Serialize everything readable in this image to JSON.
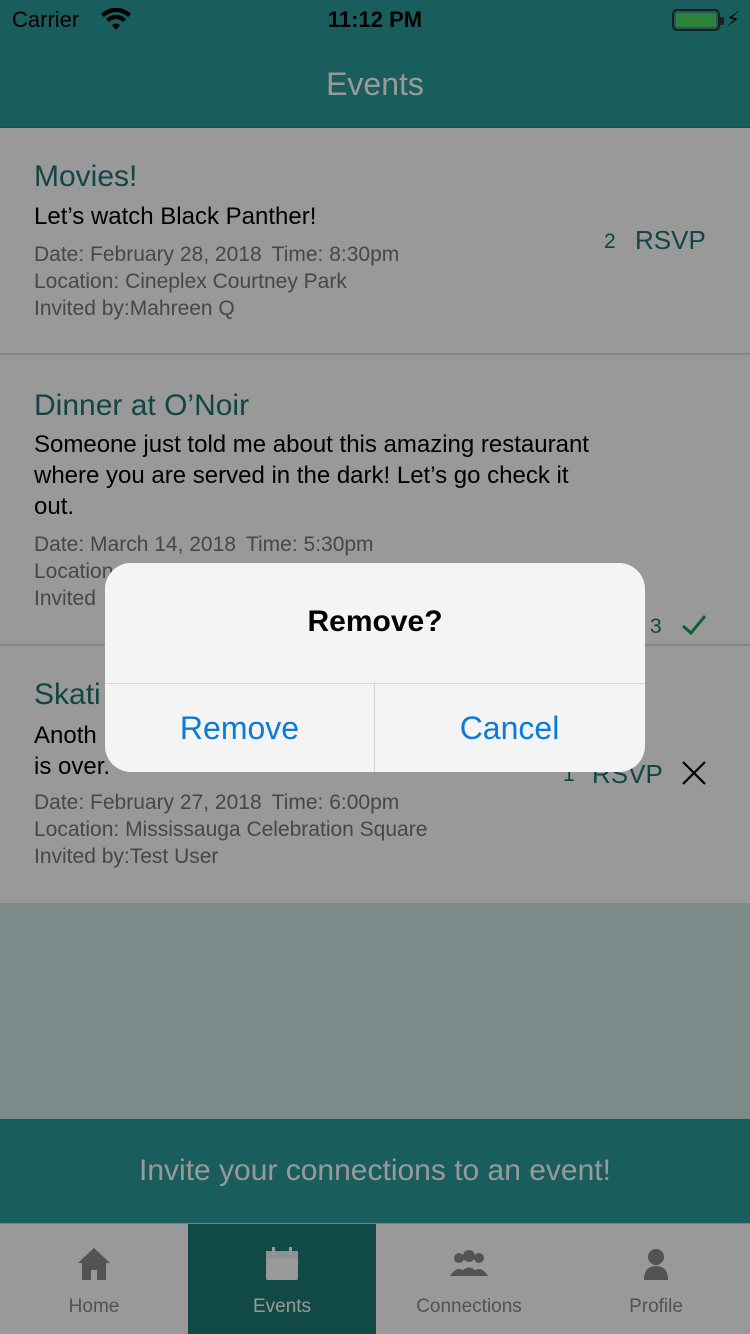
{
  "status_bar": {
    "carrier": "Carrier",
    "time": "11:12 PM",
    "battery_color": "#4cd964"
  },
  "nav": {
    "title": "Events"
  },
  "events": [
    {
      "title": "Movies!",
      "description": "Let’s watch Black Panther!",
      "date": "Date: February 28, 2018",
      "time": "Time: 8:30pm",
      "location": "Location: Cineplex Courtney Park",
      "invited_by": "Invited by:Mahreen Q",
      "count": "2",
      "rsvp_label": "RSVP",
      "status_icon": "none"
    },
    {
      "title": "Dinner at O’Noir",
      "description": "Someone just told me about this amazing restaurant where you are served in the dark! Let’s go check it out.",
      "date": "Date: March 14, 2018",
      "time": "Time: 5:30pm",
      "location": "Location",
      "invited_by": "Invited",
      "count": "3",
      "status_icon": "check-icon"
    },
    {
      "title": "Skati",
      "description_line1": "Anoth",
      "description_line2": "is over.",
      "date": "Date: February 27, 2018",
      "time": "Time: 6:00pm",
      "location": "Location: Mississauga Celebration Square",
      "invited_by": "Invited by:Test User",
      "count": "1",
      "rsvp_label": "RSVP",
      "status_icon": "x-icon"
    }
  ],
  "invite_bar": {
    "label": "Invite your connections to an event!"
  },
  "tabs": [
    {
      "label": "Home",
      "icon": "home-icon",
      "active": false
    },
    {
      "label": "Events",
      "icon": "calendar-icon",
      "active": true
    },
    {
      "label": "Connections",
      "icon": "people-icon",
      "active": false
    },
    {
      "label": "Profile",
      "icon": "person-icon",
      "active": false
    }
  ],
  "alert": {
    "title": "Remove?",
    "confirm_label": "Remove",
    "cancel_label": "Cancel"
  },
  "colors": {
    "primary": "#2a9d99",
    "active_tab": "#1d7a77",
    "accent_text": "#1e7572",
    "link_blue": "#0a7bd6",
    "check_green": "#1aa34a"
  }
}
